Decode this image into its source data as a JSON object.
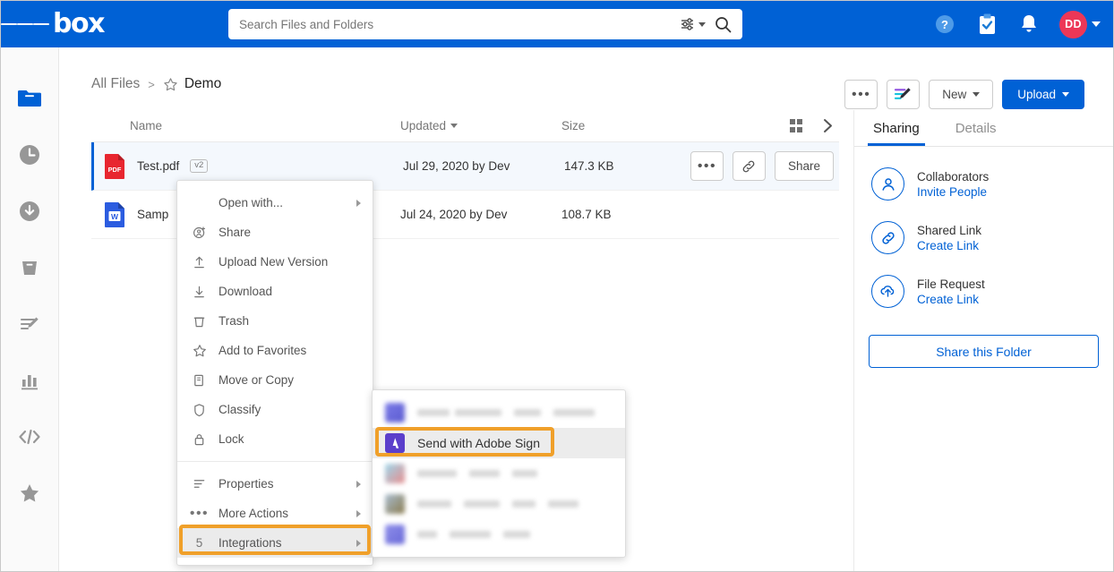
{
  "brand": {
    "name": "box",
    "blue": "#0061D5",
    "orange": "#F0A02A",
    "avatar_color": "#ED3757"
  },
  "topbar": {
    "menu_icon": "hamburger-icon",
    "search": {
      "placeholder": "Search Files and Folders",
      "value": "",
      "filter_icon": "filter-sliders-icon",
      "search_icon": "search-icon"
    },
    "help_icon": "help-circle-icon",
    "tasks_icon": "clipboard-check-icon",
    "notifications_icon": "bell-icon",
    "avatar_initials": "DD"
  },
  "sidebar": {
    "items": [
      {
        "name": "all-files",
        "icon": "folder-icon",
        "active": true
      },
      {
        "name": "recents",
        "icon": "clock-icon",
        "active": false
      },
      {
        "name": "synced",
        "icon": "download-circle-icon",
        "active": false
      },
      {
        "name": "trash",
        "icon": "trash-icon",
        "active": false
      },
      {
        "name": "notes",
        "icon": "notes-pen-icon",
        "active": false
      },
      {
        "name": "reports",
        "icon": "bar-chart-icon",
        "active": false
      },
      {
        "name": "dev-console",
        "icon": "code-icon",
        "active": false
      },
      {
        "name": "favorites",
        "icon": "star-icon",
        "active": false
      }
    ]
  },
  "breadcrumb": {
    "root": "All Files",
    "separator": ">",
    "current": "Demo",
    "star_icon": "star-outline-icon"
  },
  "toolbar": {
    "more_label": "•••",
    "notes_icon": "box-notes-icon",
    "new_label": "New",
    "upload_label": "Upload"
  },
  "filelist": {
    "columns": {
      "name": "Name",
      "updated": "Updated",
      "size": "Size"
    },
    "sort_icon": "chevron-down-icon",
    "grid_view_icon": "grid-view-icon",
    "expand_icon": "chevron-right-icon",
    "rows": [
      {
        "icon": "pdf-file-icon",
        "name": "Test.pdf",
        "badge": "v2",
        "updated": "Jul 29, 2020 by Dev",
        "size": "147.3 KB",
        "selected": true,
        "actions": {
          "more": "•••",
          "link_icon": "link-icon",
          "share": "Share"
        }
      },
      {
        "icon": "word-file-icon",
        "name": "Samp",
        "badge": "",
        "updated": "Jul 24, 2020 by Dev",
        "size": "108.7 KB",
        "selected": false,
        "actions": {
          "more": "",
          "link_icon": "",
          "share": ""
        }
      }
    ]
  },
  "context_menu": {
    "items": [
      {
        "label": "Open with...",
        "icon": "",
        "submenu": true
      },
      {
        "label": "Share",
        "icon": "share-person-icon",
        "submenu": false
      },
      {
        "label": "Upload New Version",
        "icon": "upload-arrow-icon",
        "submenu": false
      },
      {
        "label": "Download",
        "icon": "download-arrow-icon",
        "submenu": false
      },
      {
        "label": "Trash",
        "icon": "trash-icon",
        "submenu": false
      },
      {
        "label": "Add to Favorites",
        "icon": "star-outline-icon",
        "submenu": false
      },
      {
        "label": "Move or Copy",
        "icon": "copy-icon",
        "submenu": false
      },
      {
        "label": "Classify",
        "icon": "shield-icon",
        "submenu": false
      },
      {
        "label": "Lock",
        "icon": "lock-icon",
        "submenu": false
      }
    ],
    "footer_items": [
      {
        "label": "Properties",
        "icon": "properties-lines-icon",
        "submenu": true,
        "count": ""
      },
      {
        "label": "More Actions",
        "icon": "ellipsis-icon",
        "submenu": true,
        "count": ""
      },
      {
        "label": "Integrations",
        "icon": "",
        "submenu": true,
        "count": "5",
        "highlighted": true
      }
    ]
  },
  "integrations_submenu": {
    "items": [
      {
        "label": "",
        "icon_color": "#6C6CE0",
        "redacted": true,
        "selected": false
      },
      {
        "label": "Send with Adobe Sign",
        "icon_color": "#5B3FCB",
        "redacted": false,
        "selected": true
      },
      {
        "label": "",
        "icon_color": "#8FD3E8",
        "redacted": true,
        "selected": false
      },
      {
        "label": "",
        "icon_color": "#9AA9B8",
        "redacted": true,
        "selected": false
      },
      {
        "label": "",
        "icon_color": "#7B6BE8",
        "redacted": true,
        "selected": false
      }
    ]
  },
  "sharing_panel": {
    "tabs": [
      {
        "label": "Sharing",
        "active": true
      },
      {
        "label": "Details",
        "active": false
      }
    ],
    "rows": [
      {
        "icon": "person-circle-icon",
        "title": "Collaborators",
        "link": "Invite People"
      },
      {
        "icon": "link-circle-icon",
        "title": "Shared Link",
        "link": "Create Link"
      },
      {
        "icon": "upload-cloud-circle-icon",
        "title": "File Request",
        "link": "Create Link"
      }
    ],
    "button": "Share this Folder"
  }
}
